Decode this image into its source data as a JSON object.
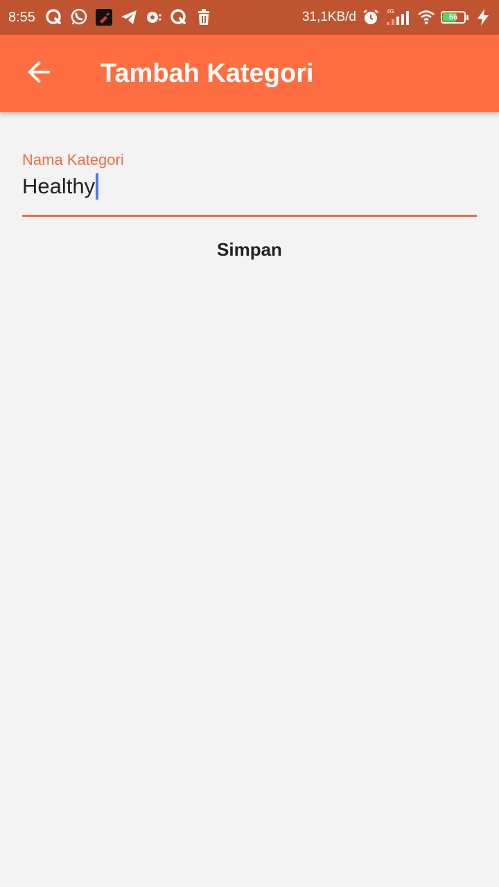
{
  "status_bar": {
    "time": "8:55",
    "net_speed": "31,1KB/d",
    "network_type": "4G",
    "battery_level": "66",
    "battery_fraction": 0.66,
    "notification_icons": [
      "q-app-icon",
      "whatsapp-icon",
      "brush-app-icon",
      "telegram-icon",
      "vpn-icon",
      "q-app-icon",
      "trash-icon"
    ],
    "status_icons": [
      "alarm-icon",
      "signal-icon",
      "wifi-icon",
      "battery-icon",
      "charging-icon"
    ]
  },
  "app_bar": {
    "title": "Tambah Kategori",
    "back_icon": "arrow-left-icon",
    "color": "#ff6e40"
  },
  "form": {
    "label": "Nama Kategori",
    "value": "Healthy",
    "accent_color": "#ef6d44"
  },
  "actions": {
    "save_label": "Simpan"
  }
}
